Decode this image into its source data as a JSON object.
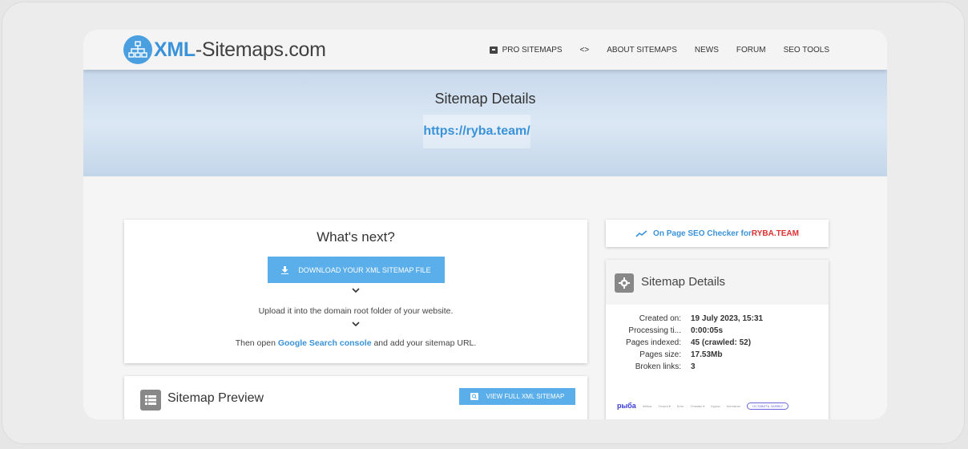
{
  "logo": {
    "prefix": "XML",
    "suffix": "-Sitemaps.com"
  },
  "nav": {
    "items": [
      "PRO SITEMAPS",
      "<>",
      "ABOUT SITEMAPS",
      "NEWS",
      "FORUM",
      "SEO TOOLS"
    ]
  },
  "hero": {
    "title": "Sitemap Details",
    "url": "https://ryba.team/"
  },
  "next": {
    "title": "What's next?",
    "download_label": "DOWNLOAD YOUR XML SITEMAP FILE",
    "upload_text": "Upload it into the domain root folder of your website.",
    "then_prefix": "Then open ",
    "console_link": "Google Search console",
    "then_suffix": " and add your sitemap URL."
  },
  "preview": {
    "title": "Sitemap Preview",
    "view_label": "VIEW FULL XML SITEMAP"
  },
  "seo": {
    "prefix": "On Page SEO Checker for ",
    "site": "RYBA.TEAM"
  },
  "details": {
    "title": "Sitemap Details",
    "rows": [
      {
        "k": "Created on:",
        "v": "19 July 2023, 15:31"
      },
      {
        "k": "Processing ti...",
        "v": "0:00:05s"
      },
      {
        "k": "Pages indexed:",
        "v": "45 (crawled: 52)"
      },
      {
        "k": "Pages size:",
        "v": "17.53Mb"
      },
      {
        "k": "Broken links:",
        "v": "3"
      }
    ]
  },
  "thumbnail": {
    "brand": "рыба",
    "links": [
      "Кейсы",
      "Услуги ▾",
      "Блог",
      "Отзывы ▾",
      "Курсы",
      "Контакты"
    ],
    "cta": "ОСТАВИТЬ ЗАЯВКУ"
  },
  "colors": {
    "accent": "#3a92d8",
    "button": "#5aaeea",
    "red": "#e03030"
  }
}
